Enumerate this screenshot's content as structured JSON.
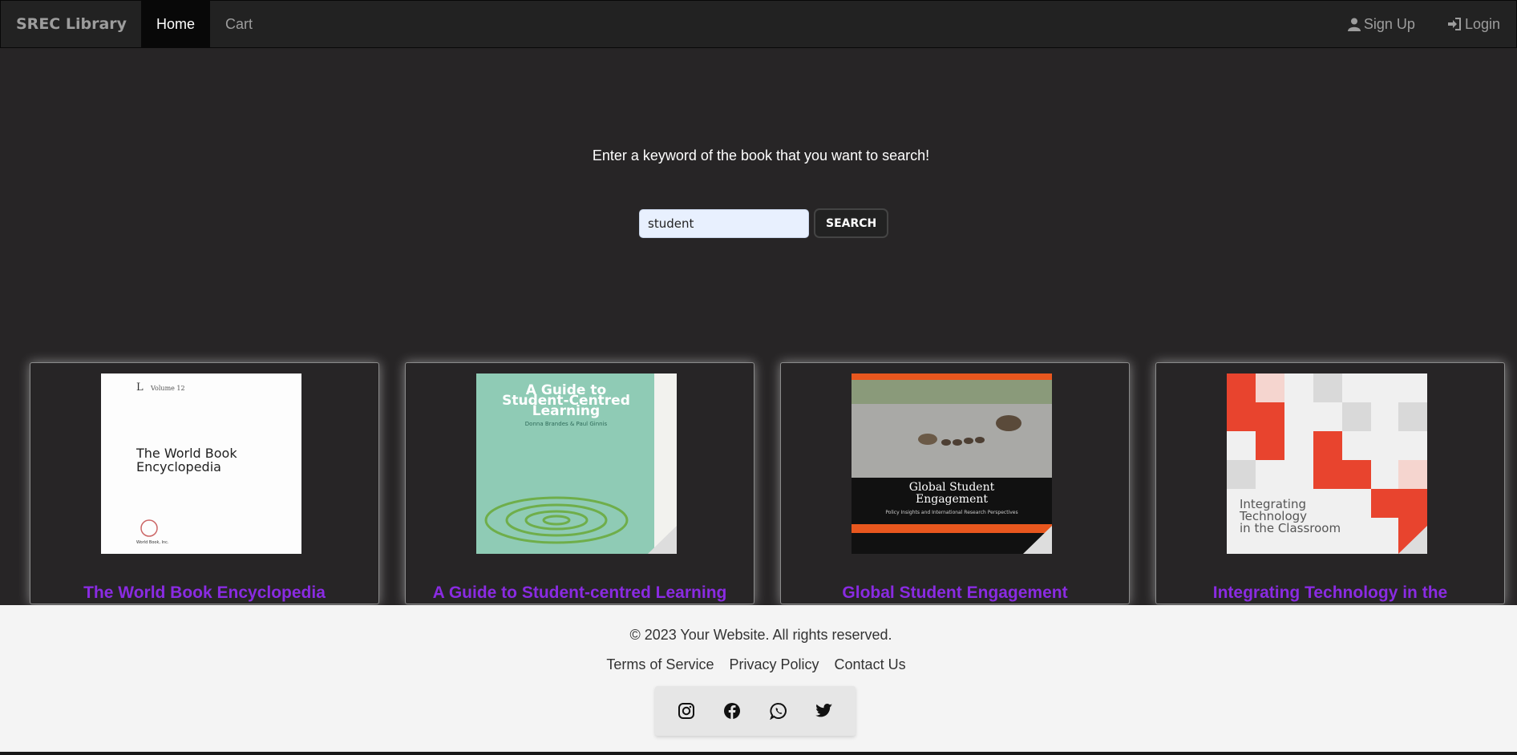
{
  "nav": {
    "brand": "SREC Library",
    "links": [
      "Home",
      "Cart"
    ],
    "right": [
      {
        "label": "Sign Up",
        "icon": "user-icon"
      },
      {
        "label": "Login",
        "icon": "login-icon"
      }
    ]
  },
  "hero": {
    "prompt": "Enter a keyword of the book that you want to search!",
    "search_value": "student",
    "search_button": "SEARCH"
  },
  "books": [
    {
      "title": "The World Book Encyclopedia",
      "cover_text": [
        "Volume 12",
        "The World Book",
        "Encyclopedia",
        "World Book, Inc."
      ]
    },
    {
      "title": "A Guide to Student-centred Learning",
      "cover_text": [
        "A Guide to",
        "Student-Centred",
        "Learning",
        "Donna Brandes & Paul Ginnis"
      ]
    },
    {
      "title": "Global Student Engagement",
      "cover_text": [
        "Global Student",
        "Engagement",
        "Policy Insights and International Research Perspectives"
      ]
    },
    {
      "title": "Integrating Technology in the",
      "cover_text": [
        "Integrating",
        "Technology",
        "in the Classroom"
      ]
    }
  ],
  "footer": {
    "copyright": "© 2023 Your Website. All rights reserved.",
    "links": [
      "Terms of Service",
      "Privacy Policy",
      "Contact Us"
    ],
    "social": [
      "instagram-icon",
      "facebook-icon",
      "whatsapp-icon",
      "twitter-icon"
    ]
  }
}
